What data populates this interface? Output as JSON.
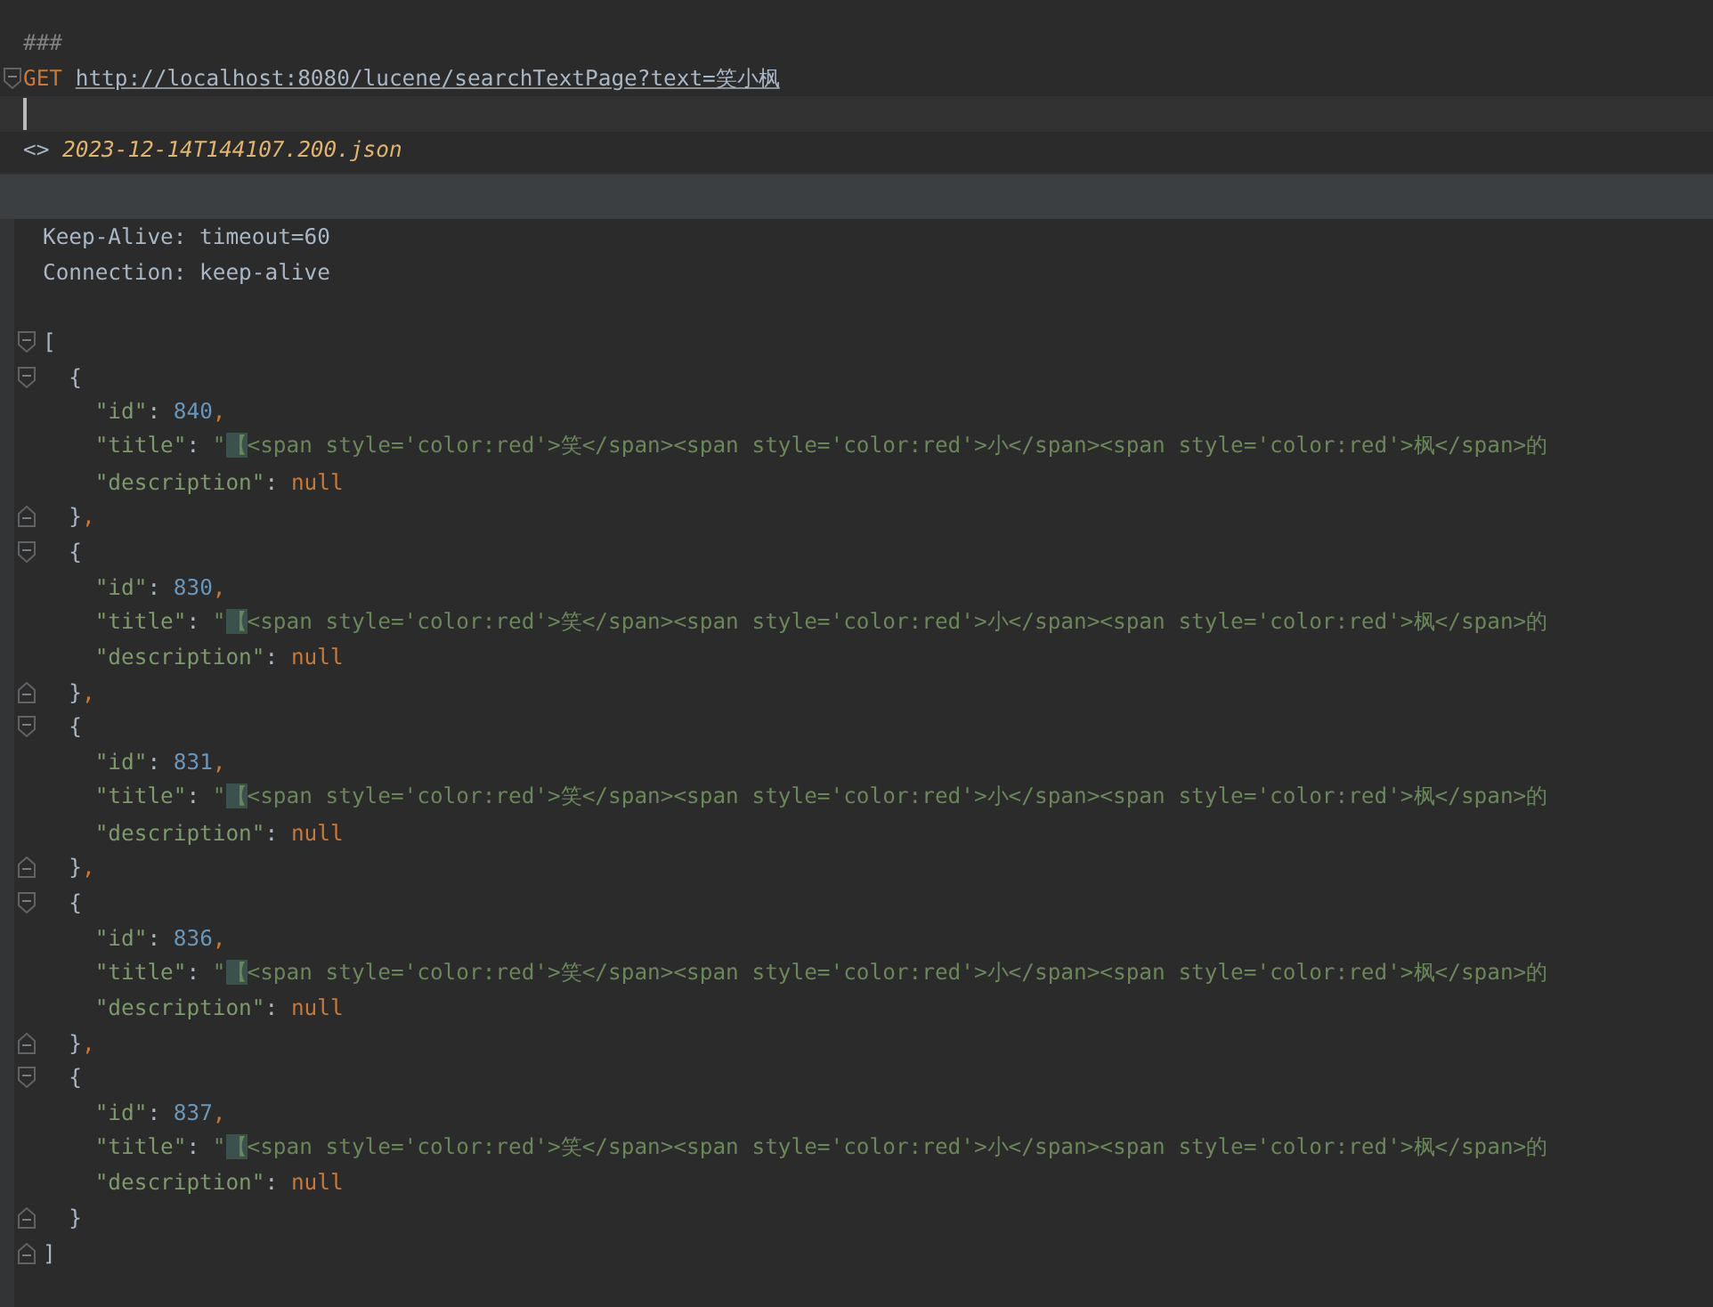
{
  "request": {
    "lines": [
      {
        "current": false,
        "tokens": [
          {
            "kind": "comment",
            "text": "###"
          }
        ]
      },
      {
        "current": false,
        "kind": "fold-start",
        "tokens": [
          {
            "kind": "method",
            "text": "GET "
          },
          {
            "kind": "url",
            "text": "http://localhost:8080/lucene/searchTextPage?text=笑小枫"
          }
        ]
      },
      {
        "current": true
      },
      {
        "current": false,
        "tokens": [
          {
            "kind": "punct",
            "text": "<> "
          },
          {
            "kind": "file",
            "text": "2023-12-14T144107.200.json"
          }
        ]
      }
    ]
  },
  "response": {
    "lines": [
      {
        "tokens": [
          {
            "kind": "header",
            "text": "Keep-Alive: timeout=60"
          }
        ]
      },
      {
        "tokens": [
          {
            "kind": "header",
            "text": "Connection: keep-alive"
          }
        ]
      },
      {
        "kind": "blank"
      },
      {
        "kind": "fold-start",
        "tokens": [
          {
            "kind": "brace",
            "text": "["
          }
        ]
      },
      {
        "kind": "fold-start",
        "tokens": [
          {
            "kind": "brace",
            "text": "  {"
          }
        ]
      },
      {
        "tokens": [
          {
            "kind": "key",
            "text": "    \"id\""
          },
          {
            "kind": "punct",
            "text": ": "
          },
          {
            "kind": "number",
            "text": "840"
          },
          {
            "kind": "comma",
            "text": ","
          }
        ]
      },
      {
        "tokens": [
          {
            "kind": "key",
            "text": "    \"title\""
          },
          {
            "kind": "punct",
            "text": ": "
          },
          {
            "kind": "string",
            "text": "\""
          },
          {
            "kind": "match",
            "text": "【"
          },
          {
            "kind": "string",
            "text": "<span style='color:red'>笑</span><span style='color:red'>小</span><span style='color:red'>枫</span>的"
          }
        ]
      },
      {
        "tokens": [
          {
            "kind": "key",
            "text": "    \"description\""
          },
          {
            "kind": "punct",
            "text": ": "
          },
          {
            "kind": "null",
            "text": "null"
          }
        ]
      },
      {
        "kind": "fold-end",
        "tokens": [
          {
            "kind": "brace",
            "text": "  }"
          },
          {
            "kind": "comma",
            "text": ","
          }
        ]
      },
      {
        "kind": "fold-start",
        "tokens": [
          {
            "kind": "brace",
            "text": "  {"
          }
        ]
      },
      {
        "tokens": [
          {
            "kind": "key",
            "text": "    \"id\""
          },
          {
            "kind": "punct",
            "text": ": "
          },
          {
            "kind": "number",
            "text": "830"
          },
          {
            "kind": "comma",
            "text": ","
          }
        ]
      },
      {
        "tokens": [
          {
            "kind": "key",
            "text": "    \"title\""
          },
          {
            "kind": "punct",
            "text": ": "
          },
          {
            "kind": "string",
            "text": "\""
          },
          {
            "kind": "match",
            "text": "【"
          },
          {
            "kind": "string",
            "text": "<span style='color:red'>笑</span><span style='color:red'>小</span><span style='color:red'>枫</span>的"
          }
        ]
      },
      {
        "tokens": [
          {
            "kind": "key",
            "text": "    \"description\""
          },
          {
            "kind": "punct",
            "text": ": "
          },
          {
            "kind": "null",
            "text": "null"
          }
        ]
      },
      {
        "kind": "fold-end",
        "tokens": [
          {
            "kind": "brace",
            "text": "  }"
          },
          {
            "kind": "comma",
            "text": ","
          }
        ]
      },
      {
        "kind": "fold-start",
        "tokens": [
          {
            "kind": "brace",
            "text": "  {"
          }
        ]
      },
      {
        "tokens": [
          {
            "kind": "key",
            "text": "    \"id\""
          },
          {
            "kind": "punct",
            "text": ": "
          },
          {
            "kind": "number",
            "text": "831"
          },
          {
            "kind": "comma",
            "text": ","
          }
        ]
      },
      {
        "tokens": [
          {
            "kind": "key",
            "text": "    \"title\""
          },
          {
            "kind": "punct",
            "text": ": "
          },
          {
            "kind": "string",
            "text": "\""
          },
          {
            "kind": "match",
            "text": "【"
          },
          {
            "kind": "string",
            "text": "<span style='color:red'>笑</span><span style='color:red'>小</span><span style='color:red'>枫</span>的"
          }
        ]
      },
      {
        "tokens": [
          {
            "kind": "key",
            "text": "    \"description\""
          },
          {
            "kind": "punct",
            "text": ": "
          },
          {
            "kind": "null",
            "text": "null"
          }
        ]
      },
      {
        "kind": "fold-end",
        "tokens": [
          {
            "kind": "brace",
            "text": "  }"
          },
          {
            "kind": "comma",
            "text": ","
          }
        ]
      },
      {
        "kind": "fold-start",
        "tokens": [
          {
            "kind": "brace",
            "text": "  {"
          }
        ]
      },
      {
        "tokens": [
          {
            "kind": "key",
            "text": "    \"id\""
          },
          {
            "kind": "punct",
            "text": ": "
          },
          {
            "kind": "number",
            "text": "836"
          },
          {
            "kind": "comma",
            "text": ","
          }
        ]
      },
      {
        "tokens": [
          {
            "kind": "key",
            "text": "    \"title\""
          },
          {
            "kind": "punct",
            "text": ": "
          },
          {
            "kind": "string",
            "text": "\""
          },
          {
            "kind": "match",
            "text": "【"
          },
          {
            "kind": "string",
            "text": "<span style='color:red'>笑</span><span style='color:red'>小</span><span style='color:red'>枫</span>的"
          }
        ]
      },
      {
        "tokens": [
          {
            "kind": "key",
            "text": "    \"description\""
          },
          {
            "kind": "punct",
            "text": ": "
          },
          {
            "kind": "null",
            "text": "null"
          }
        ]
      },
      {
        "kind": "fold-end",
        "tokens": [
          {
            "kind": "brace",
            "text": "  }"
          },
          {
            "kind": "comma",
            "text": ","
          }
        ]
      },
      {
        "kind": "fold-start",
        "tokens": [
          {
            "kind": "brace",
            "text": "  {"
          }
        ]
      },
      {
        "tokens": [
          {
            "kind": "key",
            "text": "    \"id\""
          },
          {
            "kind": "punct",
            "text": ": "
          },
          {
            "kind": "number",
            "text": "837"
          },
          {
            "kind": "comma",
            "text": ","
          }
        ]
      },
      {
        "tokens": [
          {
            "kind": "key",
            "text": "    \"title\""
          },
          {
            "kind": "punct",
            "text": ": "
          },
          {
            "kind": "string",
            "text": "\""
          },
          {
            "kind": "match",
            "text": "【"
          },
          {
            "kind": "string",
            "text": "<span style='color:red'>笑</span><span style='color:red'>小</span><span style='color:red'>枫</span>的"
          }
        ]
      },
      {
        "tokens": [
          {
            "kind": "key",
            "text": "    \"description\""
          },
          {
            "kind": "punct",
            "text": ": "
          },
          {
            "kind": "null",
            "text": "null"
          }
        ]
      },
      {
        "kind": "fold-end",
        "tokens": [
          {
            "kind": "brace",
            "text": "  }"
          }
        ]
      },
      {
        "kind": "fold-end",
        "tokens": [
          {
            "kind": "brace",
            "text": "]"
          }
        ]
      }
    ]
  }
}
